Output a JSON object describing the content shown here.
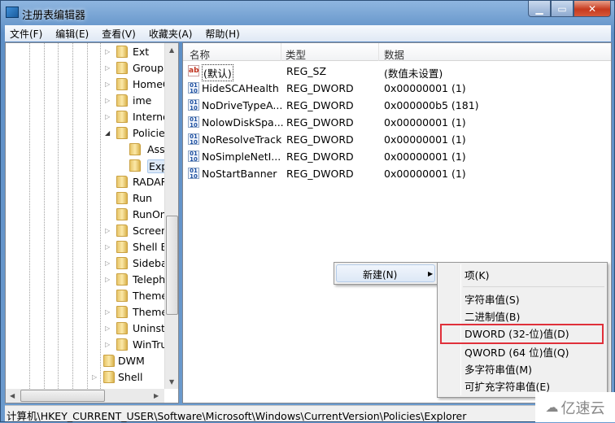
{
  "window": {
    "title": "注册表编辑器",
    "icon": "regedit-icon"
  },
  "menubar": [
    "文件(F)",
    "编辑(E)",
    "查看(V)",
    "收藏夹(A)",
    "帮助(H)"
  ],
  "tree": {
    "items": [
      {
        "label": "Ext",
        "level": 1,
        "expander": "collapsed"
      },
      {
        "label": "Group",
        "level": 1,
        "expander": "collapsed"
      },
      {
        "label": "HomeG",
        "level": 1,
        "expander": "collapsed"
      },
      {
        "label": "ime",
        "level": 1,
        "expander": "collapsed"
      },
      {
        "label": "Interne",
        "level": 1,
        "expander": "collapsed"
      },
      {
        "label": "Policie",
        "level": 1,
        "expander": "expanded"
      },
      {
        "label": "Ass",
        "level": 2,
        "expander": "none"
      },
      {
        "label": "Exp",
        "level": 2,
        "expander": "none",
        "selected": true
      },
      {
        "label": "RADAR",
        "level": 1,
        "expander": "none"
      },
      {
        "label": "Run",
        "level": 1,
        "expander": "none"
      },
      {
        "label": "RunOn",
        "level": 1,
        "expander": "none"
      },
      {
        "label": "Screen",
        "level": 1,
        "expander": "collapsed"
      },
      {
        "label": "Shell E",
        "level": 1,
        "expander": "collapsed"
      },
      {
        "label": "Sideba",
        "level": 1,
        "expander": "collapsed"
      },
      {
        "label": "Teleph",
        "level": 1,
        "expander": "collapsed"
      },
      {
        "label": "Theme",
        "level": 1,
        "expander": "none"
      },
      {
        "label": "Theme",
        "level": 1,
        "expander": "collapsed"
      },
      {
        "label": "Uninsta",
        "level": 1,
        "expander": "collapsed"
      },
      {
        "label": "WinTru",
        "level": 1,
        "expander": "collapsed"
      },
      {
        "label": "DWM",
        "level": 0,
        "expander": "none"
      },
      {
        "label": "Shell",
        "level": 0,
        "expander": "collapsed"
      }
    ]
  },
  "list": {
    "columns": [
      "名称",
      "类型",
      "数据"
    ],
    "rows": [
      {
        "name": "(默认)",
        "type": "REG_SZ",
        "data": "(数值未设置)",
        "icon": "string-value-icon"
      },
      {
        "name": "HideSCAHealth",
        "type": "REG_DWORD",
        "data": "0x00000001 (1)",
        "icon": "binary-value-icon"
      },
      {
        "name": "NoDriveTypeA...",
        "type": "REG_DWORD",
        "data": "0x000000b5 (181)",
        "icon": "binary-value-icon"
      },
      {
        "name": "NolowDiskSpa...",
        "type": "REG_DWORD",
        "data": "0x00000001 (1)",
        "icon": "binary-value-icon"
      },
      {
        "name": "NoResolveTrack",
        "type": "REG_DWORD",
        "data": "0x00000001 (1)",
        "icon": "binary-value-icon"
      },
      {
        "name": "NoSimpleNetI...",
        "type": "REG_DWORD",
        "data": "0x00000001 (1)",
        "icon": "binary-value-icon"
      },
      {
        "name": "NoStartBanner",
        "type": "REG_DWORD",
        "data": "0x00000001 (1)",
        "icon": "binary-value-icon"
      }
    ]
  },
  "context_menu": {
    "new_label": "新建(N)",
    "submenu": [
      "项(K)",
      "字符串值(S)",
      "二进制值(B)",
      "DWORD (32-位)值(D)",
      "QWORD (64 位)值(Q)",
      "多字符串值(M)",
      "可扩充字符串值(E)"
    ],
    "highlighted": "DWORD (32-位)值(D)",
    "highlight_color": "#e0303a"
  },
  "status_bar": "计算机\\HKEY_CURRENT_USER\\Software\\Microsoft\\Windows\\CurrentVersion\\Policies\\Explorer",
  "watermark": "亿速云"
}
